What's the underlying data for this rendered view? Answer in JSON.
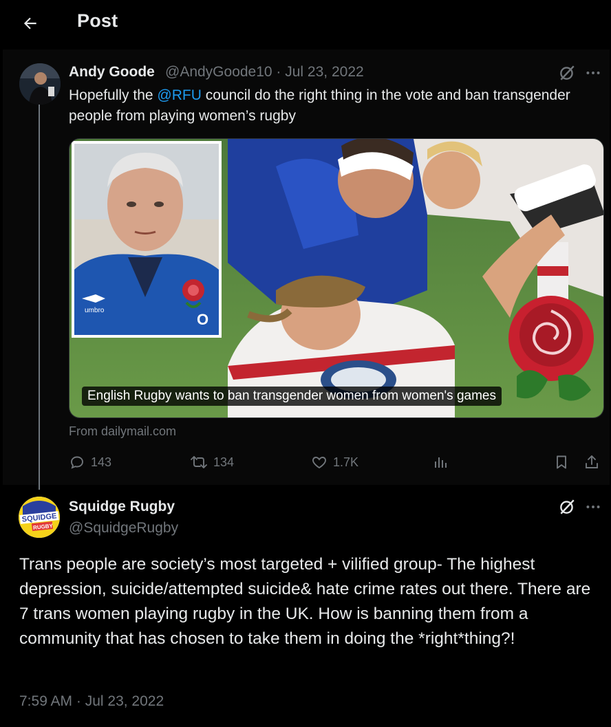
{
  "header": {
    "title": "Post"
  },
  "parent_tweet": {
    "author_name": "Andy Goode",
    "meta": "@AndyGoode10 · Jul 23, 2022",
    "text_before": "Hopefully the ",
    "mention": "@RFU",
    "text_after": " council do the right thing in the vote and ban transgender people from playing women’s rugby",
    "card": {
      "caption": "English Rugby wants to ban transgender women from women's games",
      "source": "From dailymail.com"
    },
    "stats": {
      "replies": "143",
      "reposts": "134",
      "likes": "1.7K"
    }
  },
  "main_tweet": {
    "author_name": "Squidge Rugby",
    "handle": "@SquidgeRugby",
    "avatar_text_top": "SQUIDGE",
    "avatar_text_bottom": "RUGBY",
    "text": "Trans people are society’s most targeted + vilified group- The highest depression, suicide/attempted suicide& hate crime rates out there. There are 7 trans women playing rugby in the UK. How is banning them from a community that has chosen to take them in doing the *right*thing?!",
    "timestamp": "7:59 AM · Jul 23, 2022"
  },
  "colors": {
    "background": "#000000",
    "text": "#e7e9ea",
    "muted": "#71767b",
    "link": "#1d9bf0"
  }
}
